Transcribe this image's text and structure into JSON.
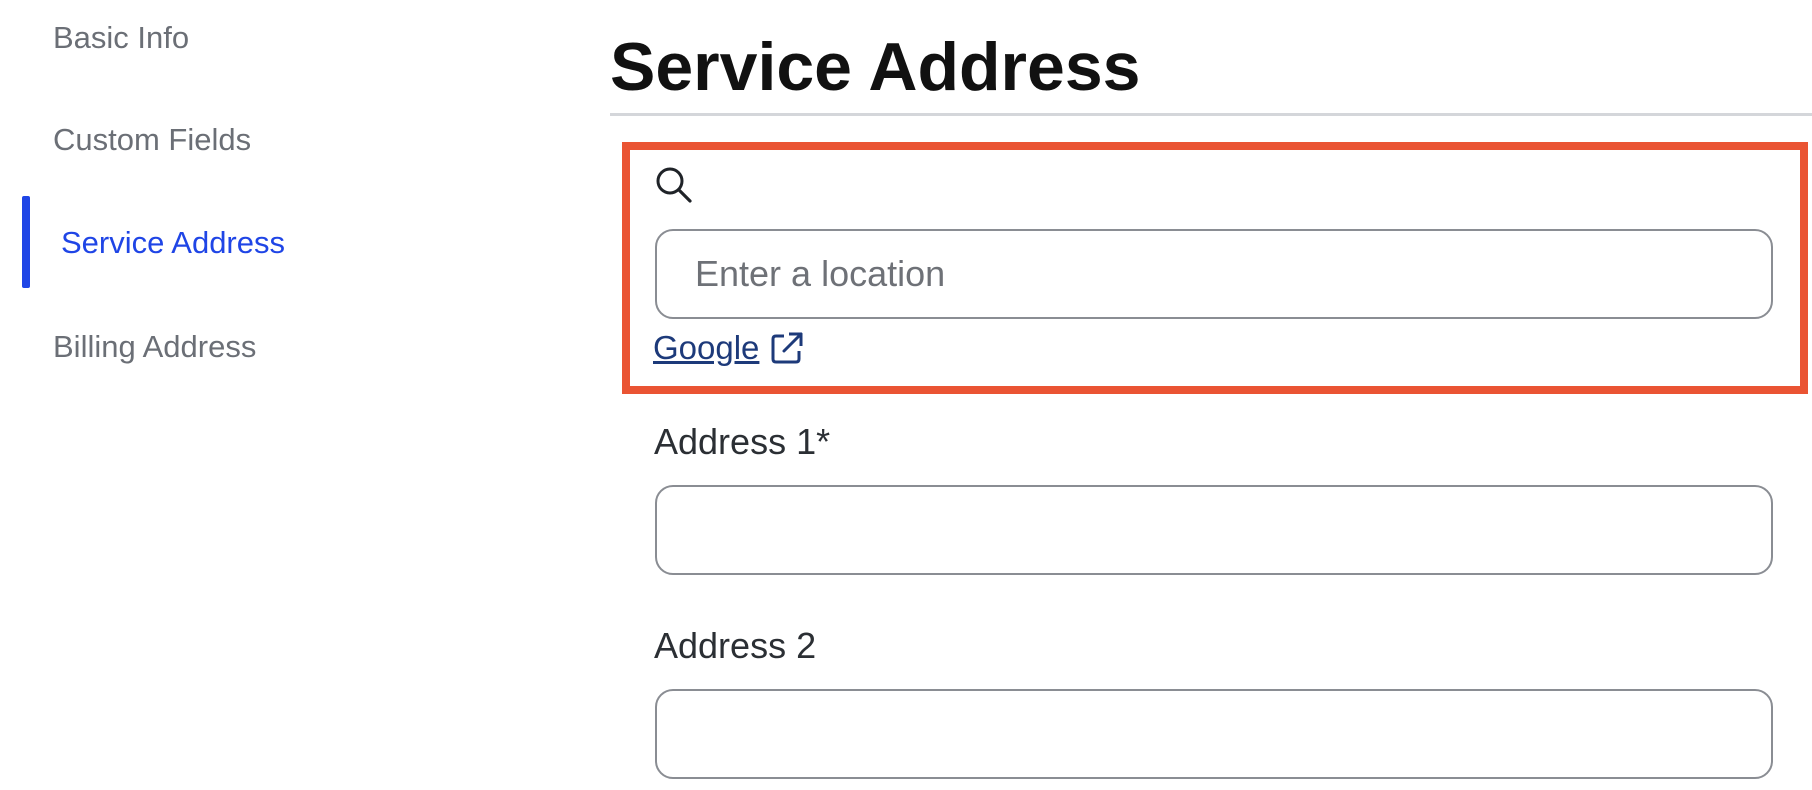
{
  "sidebar": {
    "items": [
      {
        "label": "Basic Info",
        "active": false
      },
      {
        "label": "Custom Fields",
        "active": false
      },
      {
        "label": "Service Address",
        "active": true
      },
      {
        "label": "Billing Address",
        "active": false
      }
    ]
  },
  "main": {
    "title": "Service Address",
    "search": {
      "icon": "search-icon",
      "placeholder": "Enter a location",
      "value": "",
      "link_label": "Google",
      "link_icon": "external-link-icon"
    },
    "fields": [
      {
        "label": "Address 1*",
        "value": ""
      },
      {
        "label": "Address 2",
        "value": ""
      }
    ]
  },
  "colors": {
    "accent": "#1f45e6",
    "highlight": "#ea5433",
    "link": "#1d3a7a"
  }
}
